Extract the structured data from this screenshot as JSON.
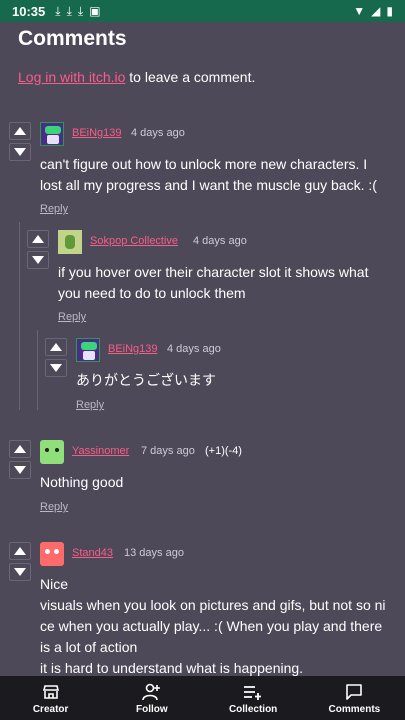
{
  "status_bar": {
    "time": "10:35",
    "notification_icons": [
      "download-icon",
      "download-icon",
      "download-icon",
      "app-icon"
    ],
    "right_icons": [
      "wifi-icon",
      "signal-icon",
      "battery-icon"
    ]
  },
  "page": {
    "heading": "Comments",
    "login_link": "Log in with itch.io",
    "login_suffix": " to leave a comment."
  },
  "comments": [
    {
      "author": "BEiNg139",
      "date": "4 days ago",
      "body_lines": [
        "can't figure out how to unlock more new characters. I",
        "lost all my progress and I want the muscle guy back. :("
      ],
      "reply": "Reply"
    },
    {
      "author": "Sokpop Collective",
      "date": "4 days ago",
      "body_lines": [
        "if you hover over their character slot it shows what",
        "you need to do to unlock them"
      ],
      "reply": "Reply"
    },
    {
      "author": "BEiNg139",
      "date": "4 days ago",
      "body_lines": [
        "ありがとうございます"
      ],
      "reply": "Reply"
    },
    {
      "author": "Yassinomer",
      "date": "7 days ago",
      "votes": "(+1)(-4)",
      "body_lines": [
        "Nothing good"
      ],
      "reply": "Reply"
    },
    {
      "author": "Stand43",
      "date": "13 days ago",
      "body_lines": [
        "Nice",
        "visuals when you look on pictures and gifs, but not so ni",
        "ce when you actually play... :( When you play and there",
        "is a lot of action",
        "it is hard to understand what is happening."
      ]
    }
  ],
  "bottom_nav": {
    "items": [
      {
        "label": "Creator",
        "icon": "creator-icon"
      },
      {
        "label": "Follow",
        "icon": "follow-icon"
      },
      {
        "label": "Collection",
        "icon": "collection-icon"
      },
      {
        "label": "Comments",
        "icon": "comments-icon"
      }
    ]
  },
  "colors": {
    "background": "#4e4958",
    "status_bar": "#17694d",
    "link": "#fa5c88",
    "nav_bar": "#1b1b1f"
  }
}
